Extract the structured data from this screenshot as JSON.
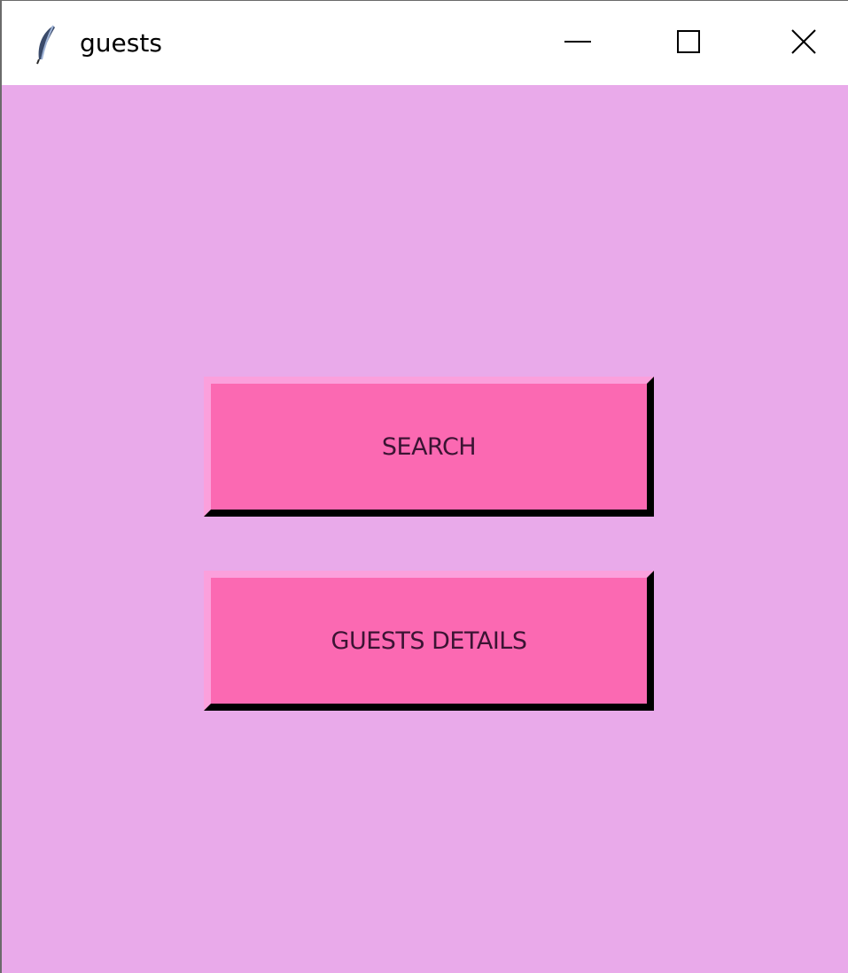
{
  "window": {
    "title": "guests",
    "app_icon": "feather-icon",
    "controls": {
      "minimize_icon": "minimize-icon",
      "maximize_icon": "maximize-icon",
      "close_icon": "close-icon"
    }
  },
  "colors": {
    "background": "#e9aaea",
    "button_face": "#fb69b2",
    "button_text": "#3b1433",
    "titlebar": "#ffffff"
  },
  "buttons": {
    "search_label": "SEARCH",
    "guests_details_label": "GUESTS DETAILS"
  }
}
